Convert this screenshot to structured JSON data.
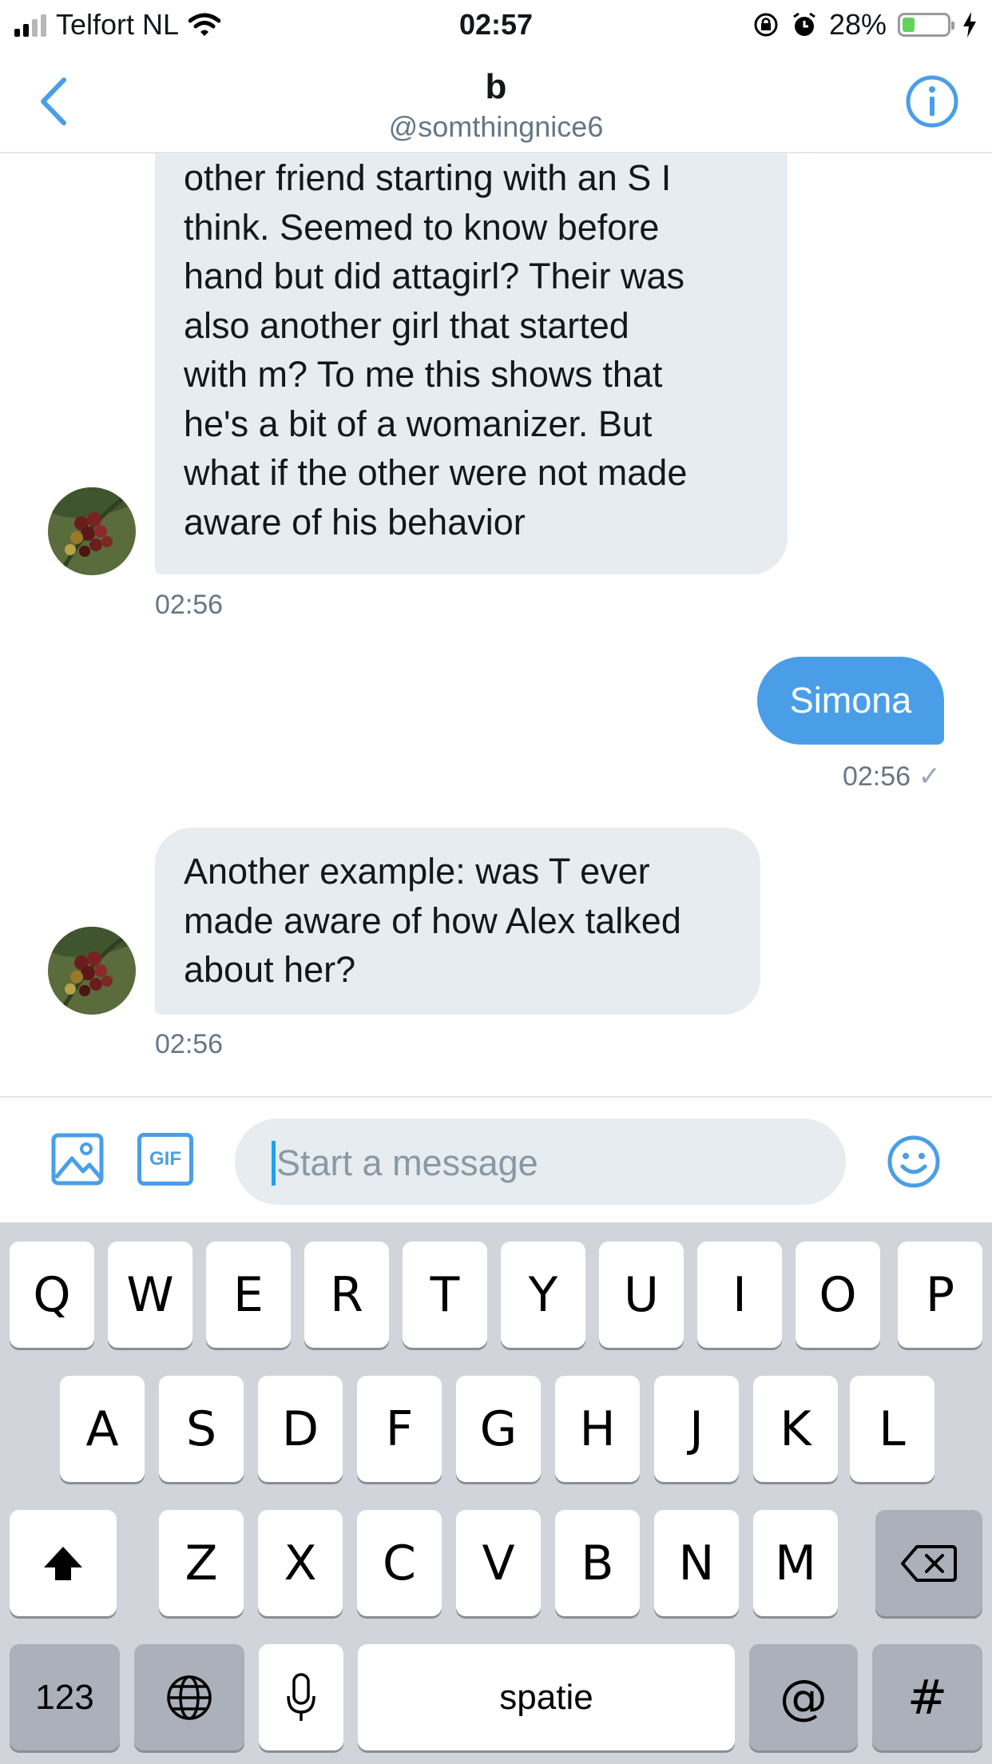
{
  "status": {
    "carrier": "Telfort NL",
    "time": "02:57",
    "battery": "28%",
    "battery_level": 0.28
  },
  "header": {
    "name": "b",
    "handle": "@somthingnice6"
  },
  "messages": [
    {
      "direction": "in",
      "lines": [
        "other friend starting with an S I",
        "think. Seemed to know before",
        "hand but did attagirl? Their was",
        "also another girl that started",
        "with m? To me this shows that",
        "he's a bit of a womanizer. But",
        "what if the other  were not made",
        "aware of his behavior"
      ],
      "time": "02:56"
    },
    {
      "direction": "out",
      "text": "Simona",
      "time": "02:56",
      "check": "✓"
    },
    {
      "direction": "in",
      "lines": [
        "Another example: was T ever",
        "made aware of how Alex talked",
        "about her?"
      ],
      "time": "02:56"
    }
  ],
  "composer": {
    "placeholder": "Start a message",
    "gif_label": "GIF"
  },
  "keyboard": {
    "row1": [
      "Q",
      "W",
      "E",
      "R",
      "T",
      "Y",
      "U",
      "I",
      "O",
      "P"
    ],
    "row2": [
      "A",
      "S",
      "D",
      "F",
      "G",
      "H",
      "J",
      "K",
      "L"
    ],
    "row3": [
      "Z",
      "X",
      "C",
      "V",
      "B",
      "N",
      "M"
    ],
    "numbers_label": "123",
    "space_label": "spatie",
    "at_label": "@",
    "hash_label": "#"
  },
  "colors": {
    "accent": "#4a9ee8",
    "bubble_in": "#e6ecf0",
    "keyboard_bg": "#d1d4db"
  }
}
